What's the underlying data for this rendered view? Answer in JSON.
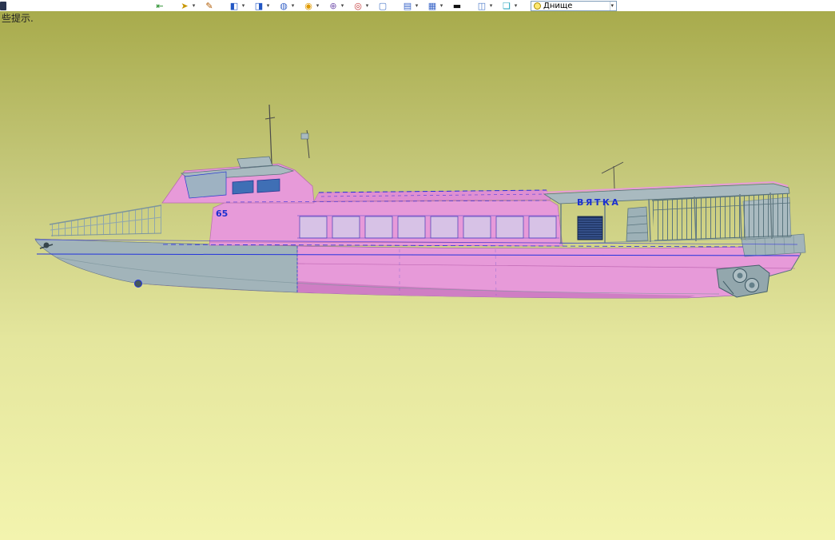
{
  "toolbar": {
    "items": [
      {
        "name": "import-model",
        "glyph": "⇤",
        "caret": ""
      },
      {
        "name": "selection-filter",
        "glyph": "➤",
        "caret": "▾"
      },
      {
        "name": "sketch-tool",
        "glyph": "✎",
        "caret": ""
      },
      {
        "name": "solid-extrude",
        "glyph": "◧",
        "caret": "▾"
      },
      {
        "name": "solid-boolean",
        "glyph": "◨",
        "caret": "▾"
      },
      {
        "name": "surface-tool",
        "glyph": "◍",
        "caret": "▾"
      },
      {
        "name": "wireframe-sphere",
        "glyph": "◉",
        "caret": "▾"
      },
      {
        "name": "zoom-selection",
        "glyph": "⊕",
        "caret": "▾"
      },
      {
        "name": "view-orientation",
        "glyph": "◎",
        "caret": "▾"
      },
      {
        "name": "viewport-frame",
        "glyph": "▢",
        "caret": ""
      },
      {
        "name": "window-layout",
        "glyph": "▤",
        "caret": "▾"
      },
      {
        "name": "display-mode-grid",
        "glyph": "▦",
        "caret": "▾"
      },
      {
        "name": "line-style",
        "glyph": "▬",
        "caret": ""
      },
      {
        "name": "panel-toggle",
        "glyph": "◫",
        "caret": "▾"
      },
      {
        "name": "layers",
        "glyph": "❏",
        "caret": "▾"
      }
    ],
    "view_selector": {
      "value": "Днище",
      "caret": "▾",
      "icon": "lightbulb"
    }
  },
  "viewport": {
    "hint_text": "些提示."
  },
  "model": {
    "name_label": "ВЯТКА",
    "bow_number": "65",
    "description": "passenger-vessel-side-view"
  },
  "colors": {
    "hull_pink": "#e79ad9",
    "hull_gray": "#a2b4ba",
    "wireframe_blue": "#2a2ae0",
    "label_blue": "#1b2fd0",
    "background_top": "#a8ab4c",
    "background_bottom": "#f3f4ae"
  }
}
